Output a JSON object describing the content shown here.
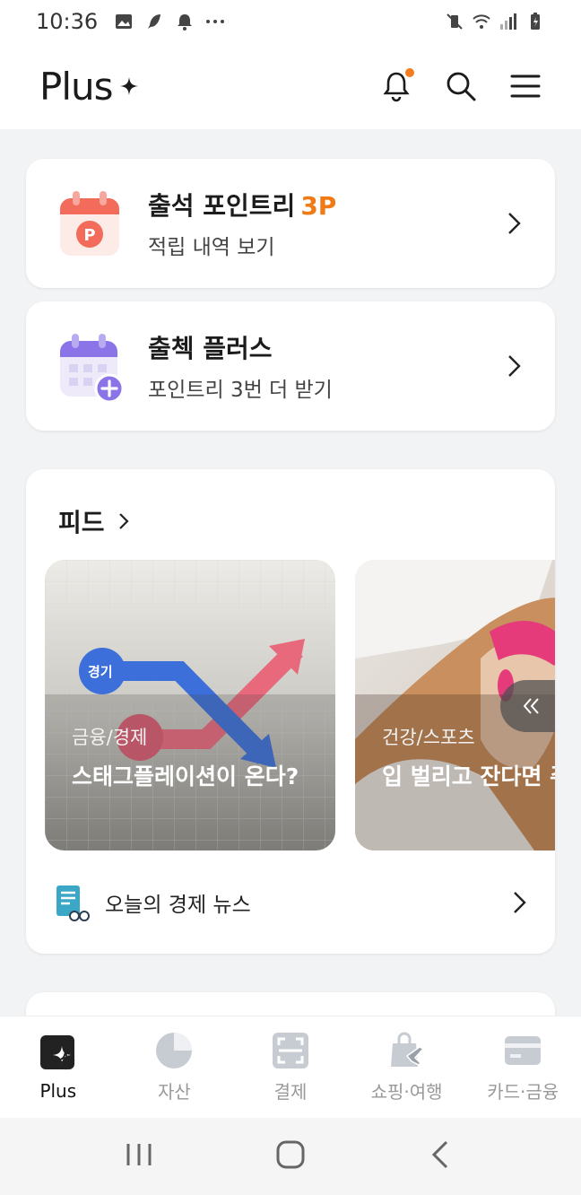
{
  "status_bar": {
    "time": "10:36",
    "left_icons": [
      "image-icon",
      "feather-icon",
      "bell-icon",
      "more-dots-icon"
    ],
    "right_icons": [
      "mute-vibrate-icon",
      "wifi-icon",
      "signal-icon",
      "battery-charging-icon"
    ]
  },
  "header": {
    "brand": "Plus",
    "icons": [
      "notification-bell-icon",
      "search-icon",
      "menu-icon"
    ],
    "notification_dot_color": "#f57c1f"
  },
  "cards": {
    "attendance": {
      "title": "출석 포인트리",
      "points": "3P",
      "subtitle": "적립 내역 보기"
    },
    "check_plus": {
      "title": "출첵 플러스",
      "subtitle": "포인트리 3번 더 받기"
    }
  },
  "feed": {
    "title": "피드",
    "items": [
      {
        "category": "금융/경제",
        "headline": "스태그플레이션이 온다?",
        "badge": "경기"
      },
      {
        "category": "건강/스포츠",
        "headline": "입 벌리고 잔다면 주"
      }
    ],
    "news_label": "오늘의 경제 뉴스"
  },
  "bottom_nav": {
    "items": [
      {
        "label": "Plus",
        "icon": "plus-sparkle-icon",
        "active": true
      },
      {
        "label": "자산",
        "icon": "pie-chart-icon",
        "active": false
      },
      {
        "label": "결제",
        "icon": "scan-icon",
        "active": false
      },
      {
        "label": "쇼핑·여행",
        "icon": "shopping-bag-plane-icon",
        "active": false
      },
      {
        "label": "카드·금융",
        "icon": "card-icon",
        "active": false
      }
    ]
  },
  "colors": {
    "accent_orange": "#f07a16",
    "background": "#f2f3f5",
    "calendar_red": "#f26b5b",
    "calendar_purple": "#8a74e8"
  }
}
